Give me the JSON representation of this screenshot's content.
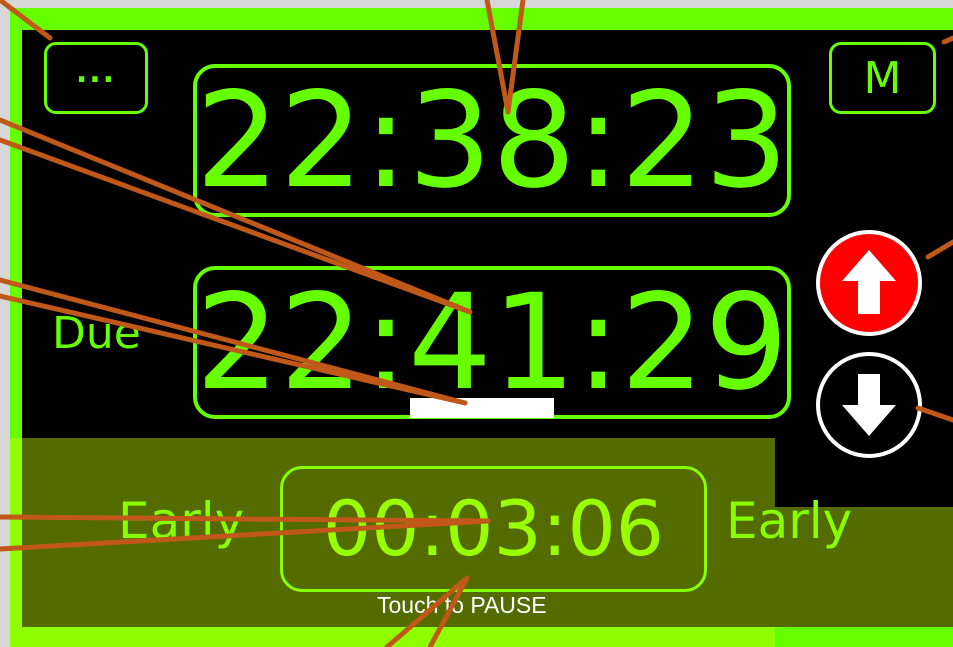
{
  "menu_button": {
    "label": "..."
  },
  "mode_button": {
    "label": "M"
  },
  "current_time": "22:38:23",
  "due": {
    "label": "Due",
    "time": "22:41:29"
  },
  "countdown": {
    "status_left": "Early",
    "status_right": "Early",
    "time": "00:03:06",
    "hint": "Touch to PAUSE"
  },
  "icons": {
    "up": "arrow-up-icon",
    "down": "arrow-down-icon"
  },
  "colors": {
    "accent": "#66ff00",
    "screen": "#000000",
    "up_button": "#ff0000",
    "callout_lines": "#c0581a"
  }
}
